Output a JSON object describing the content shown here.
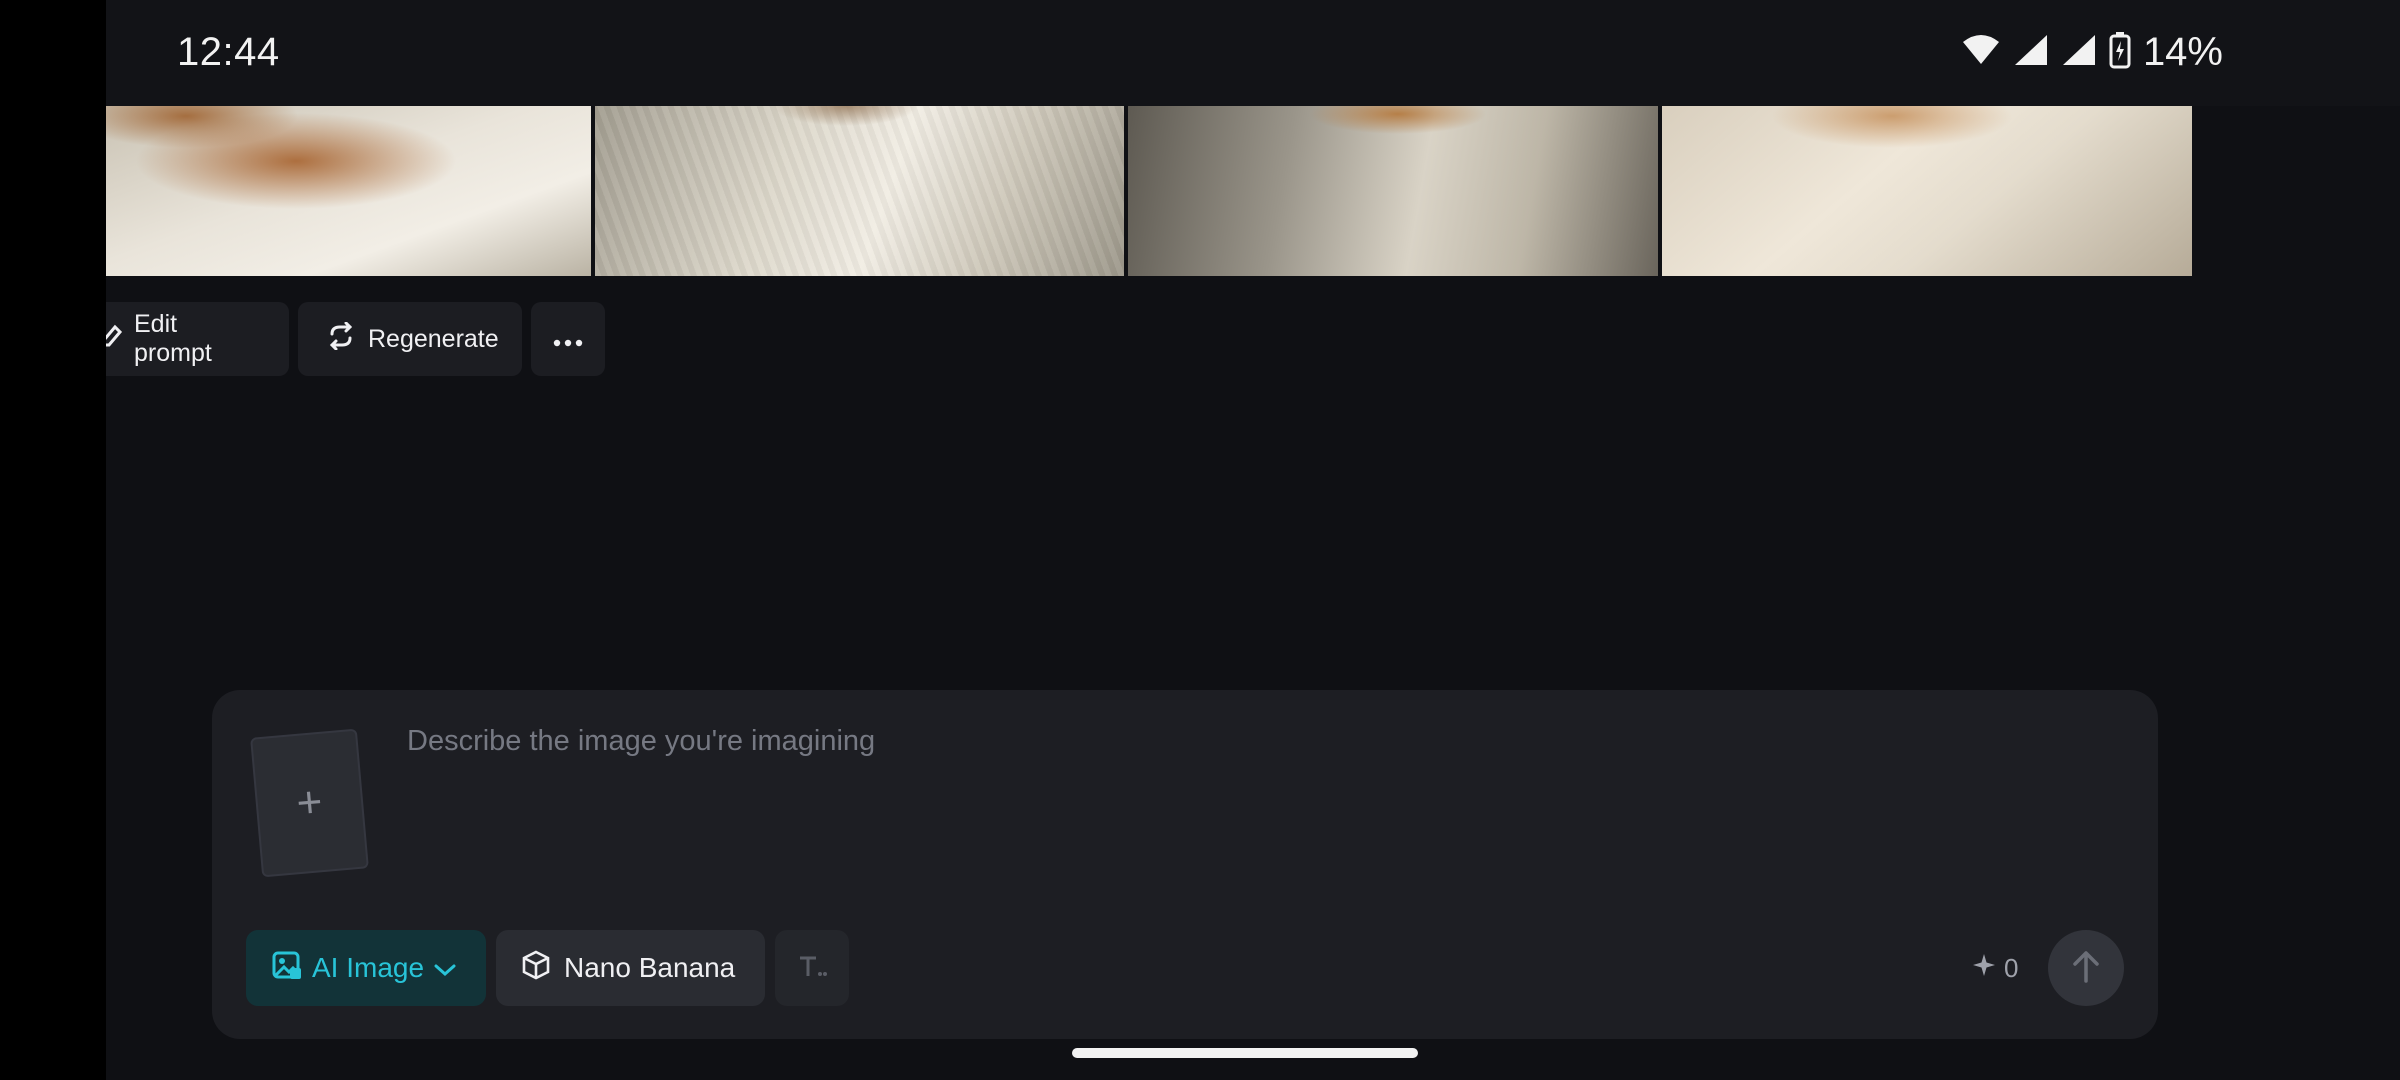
{
  "status_bar": {
    "time": "12:44",
    "battery": "14%"
  },
  "images": [
    {
      "label": "generated-image-1"
    },
    {
      "label": "generated-image-2"
    },
    {
      "label": "generated-image-3"
    },
    {
      "label": "generated-image-4"
    }
  ],
  "actions": {
    "edit_label": "Edit prompt",
    "regenerate_label": "Regenerate",
    "more_label": "..."
  },
  "composer": {
    "placeholder": "Describe the image you're imagining",
    "add_label": "+",
    "mode_label": "AI Image",
    "model_label": "Nano Banana",
    "credits": "0"
  },
  "colors": {
    "accent": "#28c4d8",
    "background": "#0f1014",
    "panel": "#1d1e23"
  }
}
